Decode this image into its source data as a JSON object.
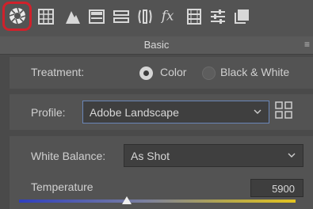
{
  "toolbar": {
    "icons": [
      "basic-aperture-icon",
      "tone-curve-grid-icon",
      "detail-mountain-icon",
      "hsl-panel-icon",
      "split-toning-icon",
      "lens-corrections-icon",
      "fx-effects-icon",
      "calibration-film-icon",
      "presets-sliders-icon",
      "snapshots-icon"
    ]
  },
  "section": {
    "title": "Basic",
    "menu_glyph": "≡"
  },
  "treatment": {
    "label": "Treatment:",
    "options": [
      "Color",
      "Black & White"
    ],
    "selected": "Color"
  },
  "profile": {
    "label": "Profile:",
    "value": "Adobe Landscape"
  },
  "white_balance": {
    "label": "White Balance:",
    "value": "As Shot"
  },
  "temperature": {
    "label": "Temperature",
    "value": "5900",
    "slider_fraction": 0.39
  },
  "colors": {
    "panel_bg": "#4a4a4a",
    "section_bg": "#535353",
    "highlight_ring": "#d0212b",
    "focus_border": "#6a86b8",
    "temp_cool": "#2f3fbf",
    "temp_warm": "#e3c31f"
  }
}
